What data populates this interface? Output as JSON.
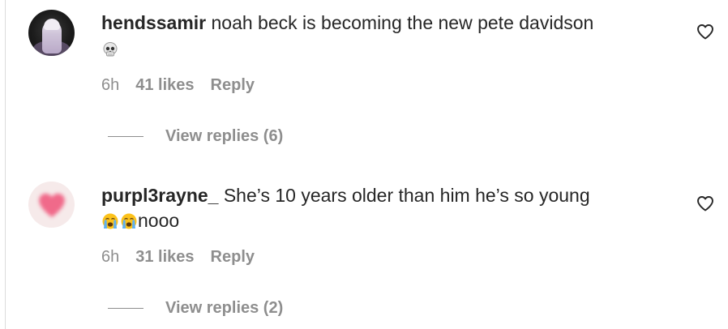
{
  "comments": [
    {
      "username": "hendssamir",
      "text": "noah beck is becoming the new pete davidson",
      "emoji": [
        "skull-emoji"
      ],
      "time": "6h",
      "likes": "41 likes",
      "reply_label": "Reply",
      "view_replies": "View replies (6)"
    },
    {
      "username": "purpl3rayne_",
      "text": "She’s 10 years older than him he’s so young",
      "emoji": [
        "loudly-crying-face-emoji",
        "loudly-crying-face-emoji"
      ],
      "text_after_emoji": "nooo",
      "time": "6h",
      "likes": "31 likes",
      "reply_label": "Reply",
      "view_replies": "View replies (2)"
    }
  ],
  "icons": {
    "like": "heart-outline-icon"
  },
  "colors": {
    "text_primary": "#262626",
    "text_secondary": "#8e8e8e",
    "avatar_heart": "#f06a8a"
  }
}
